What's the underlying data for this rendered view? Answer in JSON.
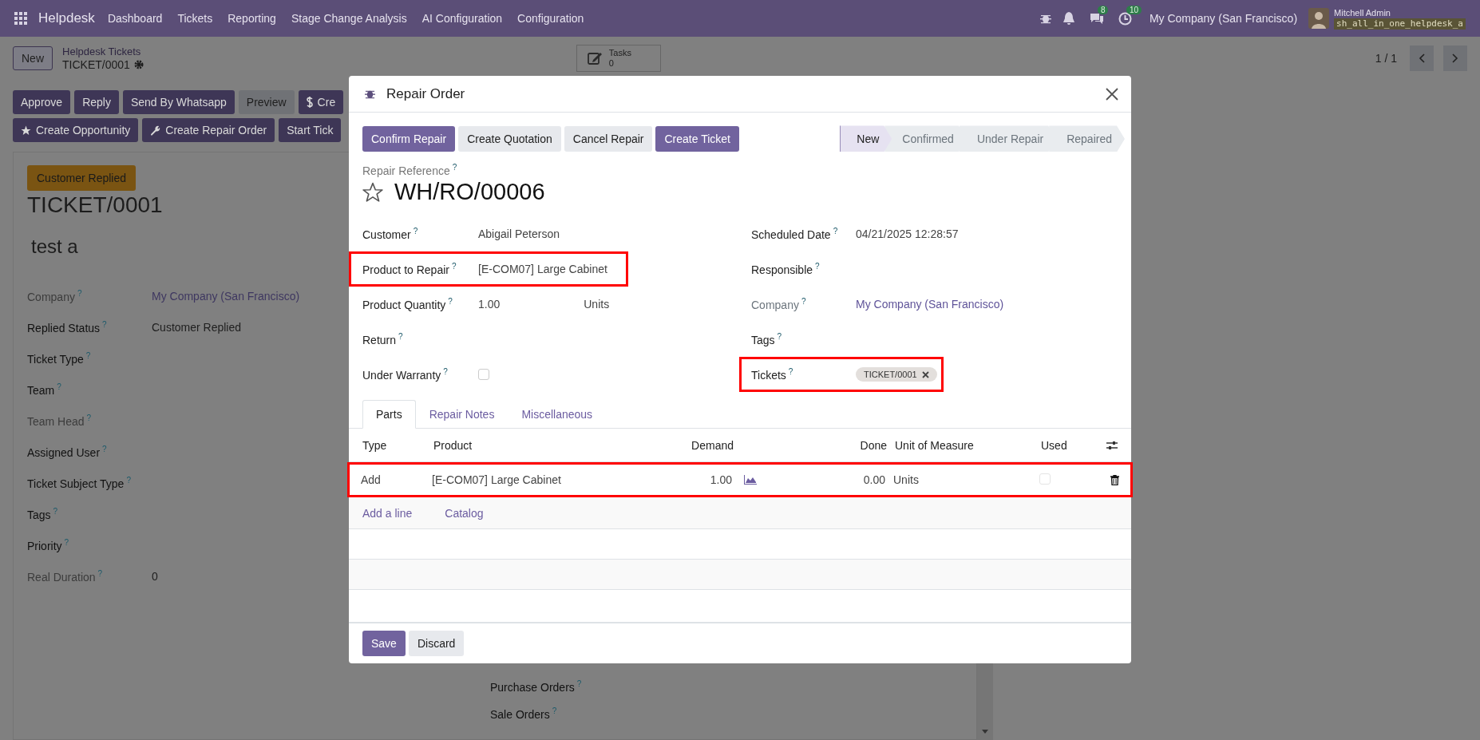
{
  "navbar": {
    "app": "Helpdesk",
    "menus": [
      "Dashboard",
      "Tickets",
      "Reporting",
      "Stage Change Analysis",
      "AI Configuration",
      "Configuration"
    ],
    "chat_count": "8",
    "activity_count": "10",
    "company": "My Company (San Francisco)",
    "user": "Mitchell Admin",
    "database": "sh_all_in_one_helpdesk_a"
  },
  "control_panel": {
    "new_button": "New",
    "breadcrumb": "Helpdesk Tickets",
    "record": "TICKET/0001",
    "stat_button": {
      "label": "Tasks",
      "value": "0"
    },
    "pager": "1 / 1"
  },
  "ticket_actions": [
    [
      {
        "label": "Approve",
        "kind": "primary"
      },
      {
        "label": "Reply",
        "kind": "primary"
      },
      {
        "label": "Send By Whatsapp",
        "kind": "primary"
      },
      {
        "label": "Preview",
        "kind": "secondary"
      },
      {
        "label": "Cre",
        "kind": "dollar"
      }
    ],
    [
      {
        "label": "Create Opportunity",
        "kind": "star"
      },
      {
        "label": "Create Repair Order",
        "kind": "wrench"
      },
      {
        "label": "Start Tick",
        "kind": "primary"
      }
    ]
  ],
  "ticket": {
    "stage_badge": "Customer Replied",
    "title": "TICKET/0001",
    "subject": "test a",
    "fields": [
      {
        "label": "Company",
        "help": "?",
        "readonly": true,
        "value": "My Company (San Francisco)",
        "link": true
      },
      {
        "label": "Replied Status",
        "help": "?",
        "readonly": false,
        "value": "Customer Replied",
        "link": false
      },
      {
        "label": "Ticket Type",
        "help": "?",
        "readonly": false
      },
      {
        "label": "Team",
        "help": "?",
        "readonly": false
      },
      {
        "label": "Team Head",
        "help": "?",
        "readonly": true
      },
      {
        "label": "Assigned User",
        "help": "?",
        "readonly": false
      },
      {
        "label": "Ticket Subject Type",
        "help": "?",
        "readonly": false
      },
      {
        "label": "Tags",
        "help": "?",
        "readonly": false
      },
      {
        "label": "Priority",
        "help": "?",
        "readonly": false
      },
      {
        "label": "Real Duration",
        "help": "?",
        "readonly": true,
        "value": "0",
        "link": false
      }
    ],
    "lower_fields": [
      {
        "label": "Purchase Orders",
        "help": "?"
      },
      {
        "label": "Sale Orders",
        "help": "?"
      }
    ]
  },
  "dialog": {
    "title": "Repair Order",
    "buttons": [
      {
        "label": "Confirm Repair",
        "kind": "primary"
      },
      {
        "label": "Create Quotation",
        "kind": "secondary"
      },
      {
        "label": "Cancel Repair",
        "kind": "secondary"
      },
      {
        "label": "Create Ticket",
        "kind": "primary"
      }
    ],
    "stages": [
      {
        "label": "New",
        "selected": true
      },
      {
        "label": "Confirmed",
        "selected": false
      },
      {
        "label": "Under Repair",
        "selected": false
      },
      {
        "label": "Repaired",
        "selected": false
      }
    ],
    "reference_label": "Repair Reference",
    "reference_help": "?",
    "reference": "WH/RO/00006",
    "left_fields": [
      {
        "label": "Customer",
        "help": "?",
        "value": "Abigail Peterson",
        "highlighted": false,
        "readonly": false
      },
      {
        "label": "Product to Repair",
        "help": "?",
        "value": "[E-COM07] Large Cabinet",
        "highlighted": true,
        "readonly": false
      },
      {
        "label": "Product Quantity",
        "help": "?",
        "value": "1.00",
        "unit": "Units",
        "highlighted": false,
        "readonly": false
      },
      {
        "label": "Return",
        "help": "?",
        "highlighted": false,
        "readonly": false
      },
      {
        "label": "Under Warranty",
        "help": "?",
        "kind": "checkbox",
        "checked": false,
        "highlighted": false,
        "readonly": false
      }
    ],
    "right_fields": [
      {
        "label": "Scheduled Date",
        "help": "?",
        "value": "04/21/2025 12:28:57",
        "link": false,
        "highlighted": false,
        "readonly": false
      },
      {
        "label": "Responsible",
        "help": "?",
        "highlighted": false,
        "readonly": false
      },
      {
        "label": "Company",
        "help": "?",
        "value": "My Company (San Francisco)",
        "link": true,
        "highlighted": false,
        "readonly": true
      },
      {
        "label": "Tags",
        "help": "?",
        "highlighted": false,
        "readonly": false
      },
      {
        "label": "Tickets",
        "help": "?",
        "kind": "tags",
        "tags": [
          "TICKET/0001"
        ],
        "highlighted": true,
        "readonly": false
      }
    ],
    "tabs": [
      {
        "label": "Parts",
        "selected": true
      },
      {
        "label": "Repair Notes",
        "selected": false
      },
      {
        "label": "Miscellaneous",
        "selected": false
      }
    ],
    "table": {
      "columns": [
        "Type",
        "Product",
        "Demand",
        "Done",
        "Unit of Measure",
        "Used"
      ],
      "rows": [
        {
          "type": "Add",
          "product": "[E-COM07] Large Cabinet",
          "demand": "1.00",
          "done": "0.00",
          "uom": "Units",
          "used": false,
          "highlighted": true
        }
      ],
      "add_line": "Add a line",
      "catalog": "Catalog"
    },
    "footer": [
      "Save",
      "Discard"
    ]
  }
}
